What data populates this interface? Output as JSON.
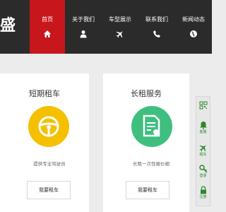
{
  "brand": {
    "char": "盛"
  },
  "nav": {
    "items": [
      {
        "label": "首页",
        "icon": "home-icon",
        "active": true
      },
      {
        "label": "关于我们",
        "icon": "user-icon",
        "active": false
      },
      {
        "label": "车型展示",
        "icon": "airplane-icon",
        "active": false
      },
      {
        "label": "联系我们",
        "icon": "phone-icon",
        "active": false
      },
      {
        "label": "新闻动态",
        "icon": "globe-icon",
        "active": false
      }
    ]
  },
  "cards": [
    {
      "title": "短期租车",
      "icon": "steering-wheel-icon",
      "circle_color": "#f5c000",
      "desc": "提供专业驾驶员",
      "button": "我要租车"
    },
    {
      "title": "长租服务",
      "icon": "document-icon",
      "circle_color": "#3fbf7f",
      "desc": "长租一次性报价细",
      "button": "我要租车"
    }
  ],
  "sidebar": {
    "items": [
      {
        "label": "",
        "icon": "qr-code-icon"
      },
      {
        "label": "客服",
        "icon": "bell-icon"
      },
      {
        "label": "租车",
        "icon": "airplane-icon"
      },
      {
        "label": "登录",
        "icon": "key-icon"
      },
      {
        "label": "注册",
        "icon": "lock-icon"
      }
    ]
  },
  "colors": {
    "header_bg": "#2b2b2b",
    "active_nav": "#c8161d",
    "page_bg": "#ececec",
    "sidebar_icon": "#2a8a2a"
  }
}
